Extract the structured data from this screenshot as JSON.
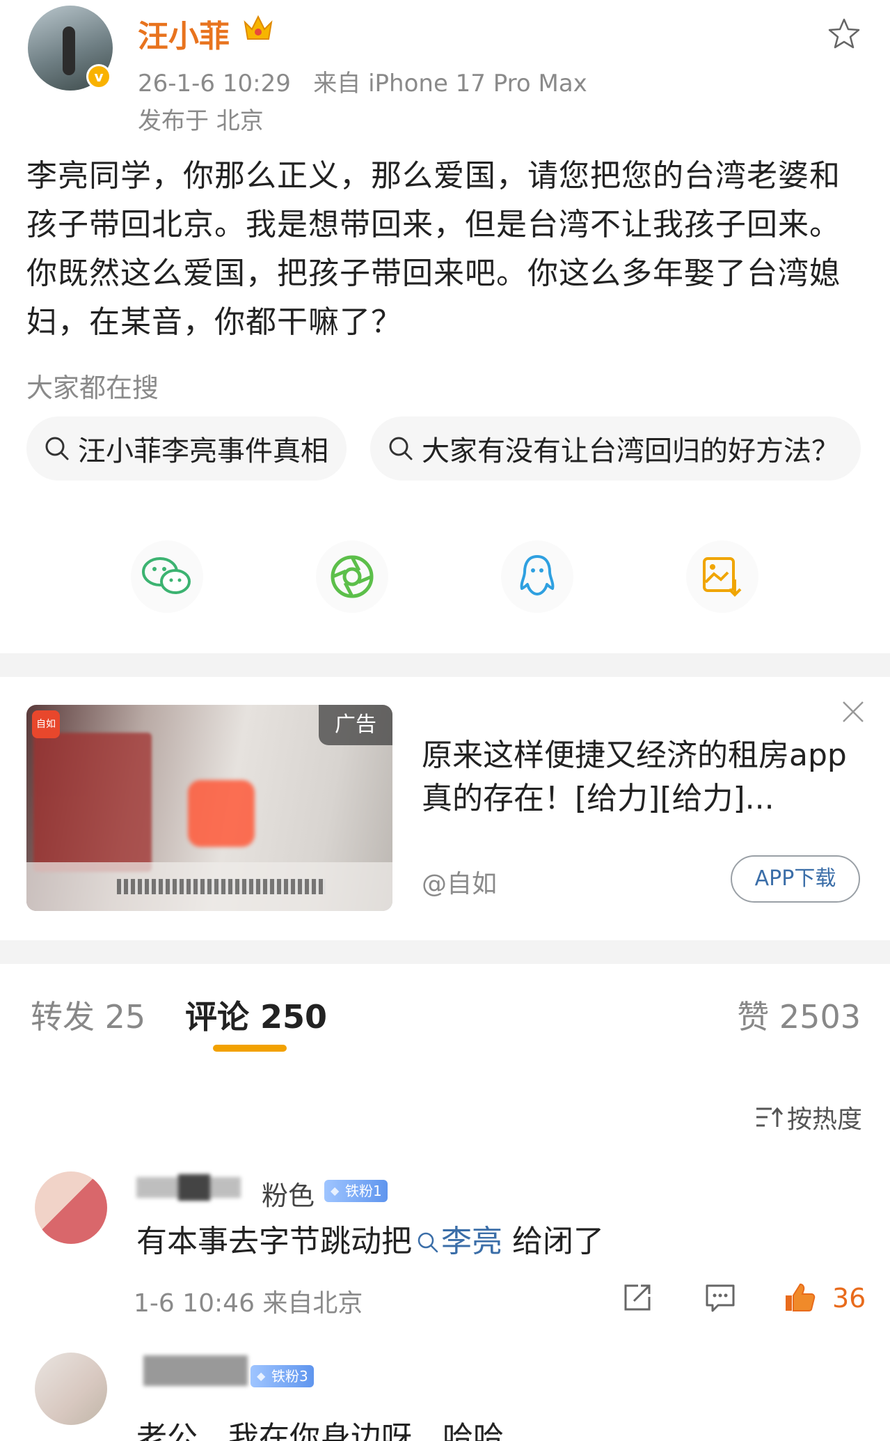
{
  "post": {
    "username": "汪小菲",
    "time": "26-1-6 10:29",
    "source": "来自 iPhone 17 Pro Max",
    "location": "发布于 北京",
    "text": "李亮同学，你那么正义，那么爱国，请您把您的台湾老婆和孩子带回北京。我是想带回来，但是台湾不让我孩子回来。你既然这么爱国，把孩子带回来吧。你这么多年娶了台湾媳妇，在某音，你都干嘛了？",
    "search_hint": "大家都在搜",
    "search_chips": [
      "汪小菲李亮事件真相",
      "大家有没有让台湾回归的好方法？"
    ],
    "share_icons": [
      "wechat-icon",
      "moments-icon",
      "qq-icon",
      "save-image-icon"
    ]
  },
  "ad": {
    "tag": "广告",
    "corner_logo": "自如",
    "title": "原来这样便捷又经济的租房app真的存在！[给力][给力]...",
    "source": "@自如",
    "button": "APP下载"
  },
  "tabs": {
    "repost": "转发 25",
    "comment": "评论 250",
    "like": "赞 2503",
    "active_color": "#f2a100"
  },
  "sort": {
    "label": "按热度"
  },
  "comments": [
    {
      "name": "粉色",
      "badge": "铁粉1",
      "text_before": "有本事去字节跳动把",
      "topic": "李亮",
      "text_after": " 给闭了",
      "time": "1-6 10:46 来自北京",
      "likes": "36"
    },
    {
      "name": "",
      "badge": "铁粉3",
      "text": "老公，我在你身边呀，哈哈"
    }
  ],
  "colors": {
    "username": "#e8731e",
    "link": "#3b6ea8",
    "like": "#e86b1c"
  }
}
